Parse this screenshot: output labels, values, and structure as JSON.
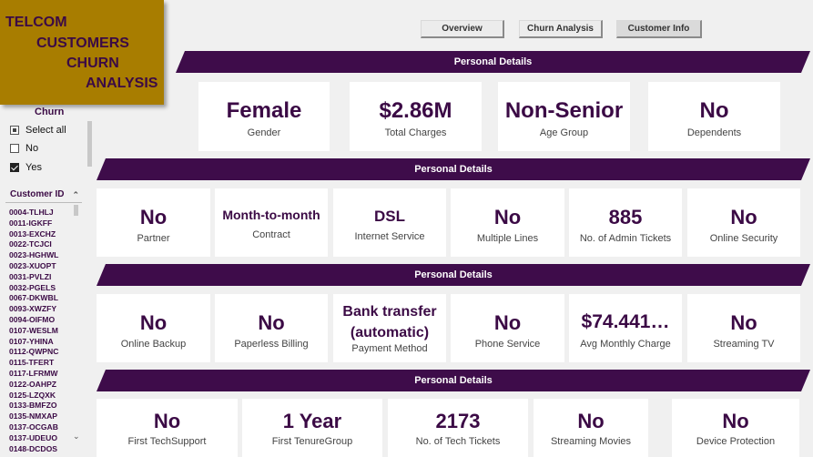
{
  "title": {
    "line1": "TELCOM",
    "line2": "CUSTOMERS",
    "line3": "CHURN",
    "line4": "ANALYSIS"
  },
  "tabs": [
    {
      "label": "Overview"
    },
    {
      "label": "Churn Analysis"
    },
    {
      "label": "Customer Info"
    }
  ],
  "churn_filter": {
    "title": "Churn",
    "options": [
      "Select all",
      "No",
      "Yes"
    ],
    "selected": "Yes"
  },
  "customer_filter": {
    "title": "Customer ID",
    "items": [
      "0004-TLHLJ",
      "0011-IGKFF",
      "0013-EXCHZ",
      "0022-TCJCI",
      "0023-HGHWL",
      "0023-XUOPT",
      "0031-PVLZI",
      "0032-PGELS",
      "0067-DKWBL",
      "0093-XWZFY",
      "0094-OIFMO",
      "0107-WESLM",
      "0107-YHINA",
      "0112-QWPNC",
      "0115-TFERT",
      "0117-LFRMW",
      "0122-OAHPZ",
      "0125-LZQXK",
      "0133-BMFZO",
      "0135-NMXAP",
      "0137-OCGAB",
      "0137-UDEUO",
      "0148-DCDOS"
    ]
  },
  "sections": [
    {
      "title": "Personal Details",
      "cards": [
        {
          "value": "Female",
          "label": "Gender"
        },
        {
          "value": "$2.86M",
          "label": "Total Charges"
        },
        {
          "value": "Non-Senior",
          "label": "Age Group"
        },
        {
          "value": "No",
          "label": "Dependents"
        }
      ]
    },
    {
      "title": "Personal Details",
      "cards": [
        {
          "value": "No",
          "label": "Partner"
        },
        {
          "value": "Month-to-month",
          "label": "Contract"
        },
        {
          "value": "DSL",
          "label": "Internet Service"
        },
        {
          "value": "No",
          "label": "Multiple Lines"
        },
        {
          "value": "885",
          "label": "No. of Admin Tickets"
        },
        {
          "value": "No",
          "label": "Online Security"
        }
      ]
    },
    {
      "title": "Personal Details",
      "cards": [
        {
          "value": "No",
          "label": "Online Backup"
        },
        {
          "value": "No",
          "label": "Paperless Billing"
        },
        {
          "value": "Bank transfer",
          "value2": "(automatic)",
          "label": "Payment Method"
        },
        {
          "value": "No",
          "label": "Phone Service"
        },
        {
          "value": "$74.441…",
          "label": "Avg Monthly Charge"
        },
        {
          "value": "No",
          "label": "Streaming TV"
        }
      ]
    },
    {
      "title": "Personal Details",
      "cards": [
        {
          "value": "No",
          "label": "First TechSupport"
        },
        {
          "value": "1 Year",
          "label": "First TenureGroup"
        },
        {
          "value": "2173",
          "label": "No. of Tech Tickets"
        },
        {
          "value": "No",
          "label": "Streaming Movies"
        },
        {
          "value": "No",
          "label": "Device Protection"
        }
      ]
    }
  ]
}
